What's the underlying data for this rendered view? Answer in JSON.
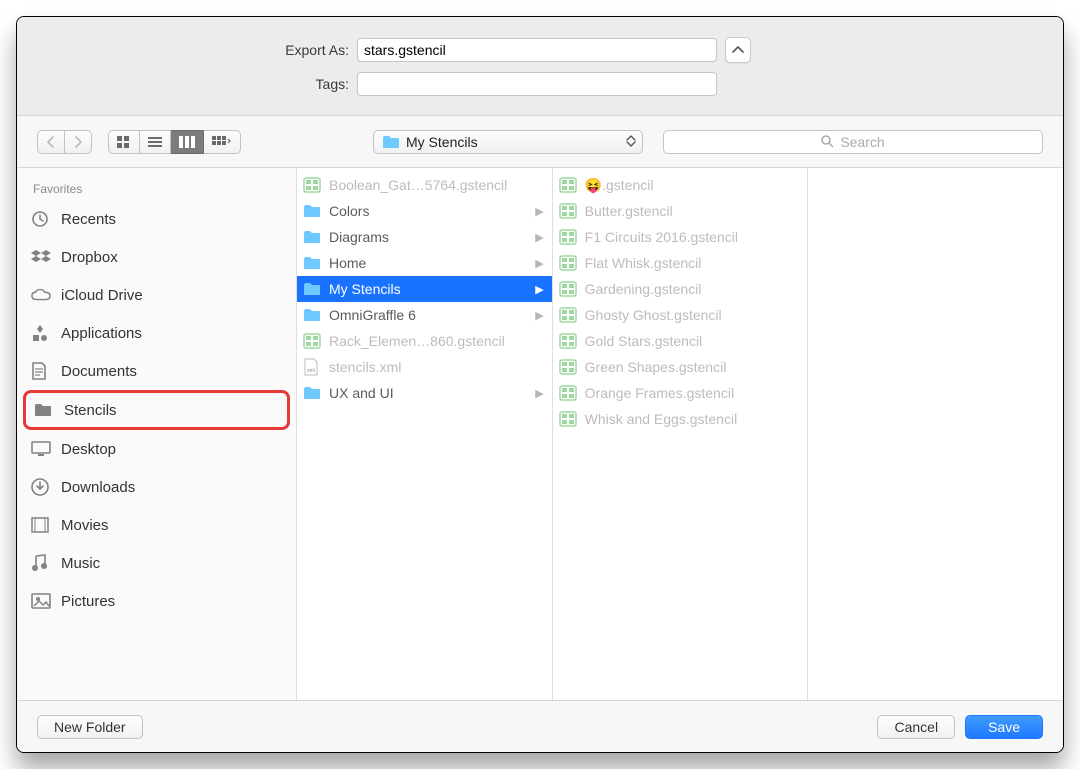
{
  "labels": {
    "export_as": "Export As:",
    "tags": "Tags:",
    "favorites": "Favorites",
    "new_folder": "New Folder",
    "cancel": "Cancel",
    "save": "Save",
    "search_placeholder": "Search"
  },
  "export_value": "stars.gstencil",
  "tags_value": "",
  "path_title": "My Stencils",
  "sidebar": [
    {
      "label": "Recents",
      "icon": "clock"
    },
    {
      "label": "Dropbox",
      "icon": "dropbox"
    },
    {
      "label": "iCloud Drive",
      "icon": "cloud"
    },
    {
      "label": "Applications",
      "icon": "apps"
    },
    {
      "label": "Documents",
      "icon": "doc"
    },
    {
      "label": "Stencils",
      "icon": "folder",
      "highlight": true
    },
    {
      "label": "Desktop",
      "icon": "desktop"
    },
    {
      "label": "Downloads",
      "icon": "download"
    },
    {
      "label": "Movies",
      "icon": "movie"
    },
    {
      "label": "Music",
      "icon": "music"
    },
    {
      "label": "Pictures",
      "icon": "picture"
    }
  ],
  "column1": [
    {
      "label": "Boolean_Gat…5764.gstencil",
      "type": "stencil",
      "dim": true
    },
    {
      "label": "Colors",
      "type": "folder",
      "arrow": true
    },
    {
      "label": "Diagrams",
      "type": "folder",
      "arrow": true
    },
    {
      "label": "Home",
      "type": "folder",
      "arrow": true
    },
    {
      "label": "My Stencils",
      "type": "folder",
      "arrow": true,
      "selected": true
    },
    {
      "label": "OmniGraffle 6",
      "type": "folder",
      "arrow": true
    },
    {
      "label": "Rack_Elemen…860.gstencil",
      "type": "stencil",
      "dim": true
    },
    {
      "label": "stencils.xml",
      "type": "xml",
      "dim": true
    },
    {
      "label": "UX and UI",
      "type": "folder",
      "arrow": true
    }
  ],
  "column2": [
    {
      "label": "😝.gstencil",
      "type": "stencil",
      "dim": true
    },
    {
      "label": "Butter.gstencil",
      "type": "stencil",
      "dim": true
    },
    {
      "label": "F1 Circuits 2016.gstencil",
      "type": "stencil",
      "dim": true
    },
    {
      "label": "Flat Whisk.gstencil",
      "type": "stencil",
      "dim": true
    },
    {
      "label": "Gardening.gstencil",
      "type": "stencil",
      "dim": true
    },
    {
      "label": "Ghosty Ghost.gstencil",
      "type": "stencil",
      "dim": true
    },
    {
      "label": "Gold Stars.gstencil",
      "type": "stencil",
      "dim": true
    },
    {
      "label": "Green Shapes.gstencil",
      "type": "stencil",
      "dim": true
    },
    {
      "label": "Orange Frames.gstencil",
      "type": "stencil",
      "dim": true
    },
    {
      "label": "Whisk and Eggs.gstencil",
      "type": "stencil",
      "dim": true
    }
  ]
}
